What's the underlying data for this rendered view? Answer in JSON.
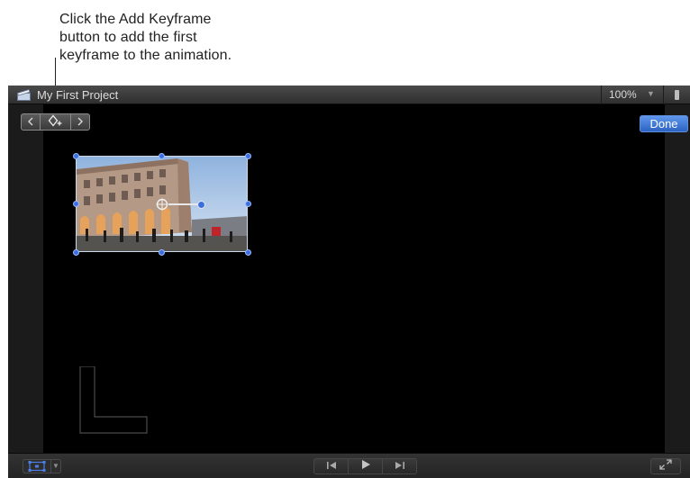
{
  "callout": {
    "lines": [
      "Click the Add Keyframe",
      "button to add the first",
      "keyframe to the animation."
    ]
  },
  "window": {
    "title": "My First Project",
    "zoom": "100%"
  },
  "viewer": {
    "done_label": "Done"
  },
  "icons": {
    "title_bar": "clapperboard-icon",
    "view_options": "view-options-icon",
    "keyframe_prev": "chevron-left-icon",
    "keyframe_add": "add-keyframe-icon",
    "keyframe_next": "chevron-right-icon",
    "clip_view": "transform-clip-icon",
    "transport": [
      "go-to-start-icon",
      "play-icon",
      "go-to-end-icon"
    ],
    "fullscreen": "fullscreen-icon"
  },
  "colors": {
    "accent": "#2f6fd8",
    "handle": "#3a6fe0",
    "canvas": "#000000"
  }
}
